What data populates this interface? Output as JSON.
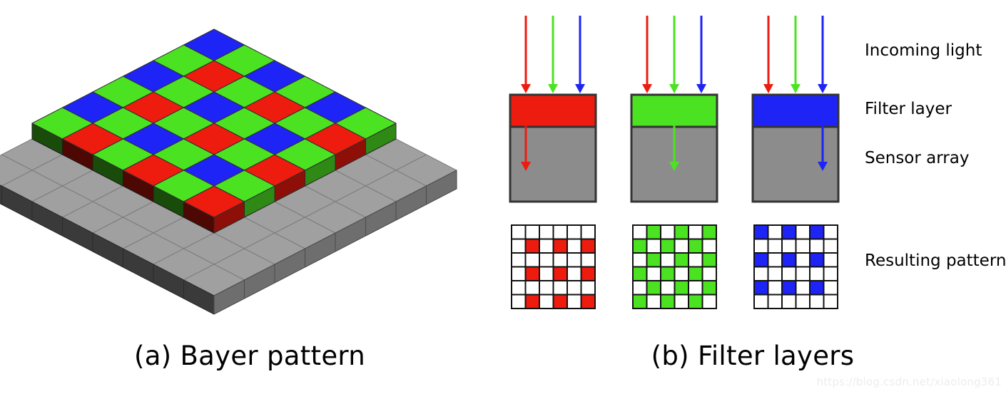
{
  "figure": {
    "title": "Bayer pattern and filter layers diagram",
    "background": "#ffffff"
  },
  "panel_a": {
    "caption": "(a) Bayer pattern",
    "description": "Isometric 3D Bayer color filter array on a gray sensor base plate",
    "base_grid": {
      "cols": 8,
      "rows": 8
    },
    "filter_grid": {
      "cols": 6,
      "rows": 6
    },
    "colors": {
      "red": "#ee1b0f",
      "green": "#4be321",
      "blue": "#1e24f5",
      "gray_top": "#a0a0a0",
      "gray_side": "#6e6e6e",
      "gray_front": "#3a3a3a",
      "red_side": "#8e0f08",
      "green_side": "#2e8a14",
      "blue_side": "#0b1094",
      "outline": "#555555"
    },
    "bayer_layout": [
      [
        "B",
        "G",
        "B",
        "G",
        "B",
        "G"
      ],
      [
        "G",
        "R",
        "G",
        "R",
        "G",
        "R"
      ],
      [
        "B",
        "G",
        "B",
        "G",
        "B",
        "G"
      ],
      [
        "G",
        "R",
        "G",
        "R",
        "G",
        "R"
      ],
      [
        "B",
        "G",
        "B",
        "G",
        "B",
        "G"
      ],
      [
        "G",
        "R",
        "G",
        "R",
        "G",
        "R"
      ]
    ]
  },
  "panel_b": {
    "caption": "(b) Filter layers",
    "labels": {
      "incoming_light": "Incoming light",
      "filter_layer": "Filter layer",
      "sensor_array": "Sensor array",
      "resulting_pattern": "Resulting pattern"
    },
    "colors": {
      "red": "#ee1b0f",
      "green": "#4be321",
      "blue": "#1e24f5",
      "sensor_gray": "#8c8c8c",
      "outline": "#333333",
      "cell_white": "#ffffff"
    },
    "columns": [
      {
        "name": "red-column",
        "filter_color": "#ee1b0f",
        "filter_name": "red",
        "incoming_arrows": [
          "#ee1b0f",
          "#4be321",
          "#1e24f5"
        ],
        "transmitted_arrow": "#ee1b0f",
        "transmitted_arrow_index": 0,
        "pattern": [
          [
            0,
            0,
            0,
            0,
            0,
            0
          ],
          [
            0,
            1,
            0,
            1,
            0,
            1
          ],
          [
            0,
            0,
            0,
            0,
            0,
            0
          ],
          [
            0,
            1,
            0,
            1,
            0,
            1
          ],
          [
            0,
            0,
            0,
            0,
            0,
            0
          ],
          [
            0,
            1,
            0,
            1,
            0,
            1
          ]
        ]
      },
      {
        "name": "green-column",
        "filter_color": "#4be321",
        "filter_name": "green",
        "incoming_arrows": [
          "#ee1b0f",
          "#4be321",
          "#1e24f5"
        ],
        "transmitted_arrow": "#4be321",
        "transmitted_arrow_index": 1,
        "pattern": [
          [
            0,
            1,
            0,
            1,
            0,
            1
          ],
          [
            1,
            0,
            1,
            0,
            1,
            0
          ],
          [
            0,
            1,
            0,
            1,
            0,
            1
          ],
          [
            1,
            0,
            1,
            0,
            1,
            0
          ],
          [
            0,
            1,
            0,
            1,
            0,
            1
          ],
          [
            1,
            0,
            1,
            0,
            1,
            0
          ]
        ]
      },
      {
        "name": "blue-column",
        "filter_color": "#1e24f5",
        "filter_name": "blue",
        "incoming_arrows": [
          "#ee1b0f",
          "#4be321",
          "#1e24f5"
        ],
        "transmitted_arrow": "#1e24f5",
        "transmitted_arrow_index": 2,
        "pattern": [
          [
            1,
            0,
            1,
            0,
            1,
            0
          ],
          [
            0,
            0,
            0,
            0,
            0,
            0
          ],
          [
            1,
            0,
            1,
            0,
            1,
            0
          ],
          [
            0,
            0,
            0,
            0,
            0,
            0
          ],
          [
            1,
            0,
            1,
            0,
            1,
            0
          ],
          [
            0,
            0,
            0,
            0,
            0,
            0
          ]
        ]
      }
    ]
  },
  "watermark": {
    "text": "https://blog.csdn.net/xiaolong361"
  }
}
